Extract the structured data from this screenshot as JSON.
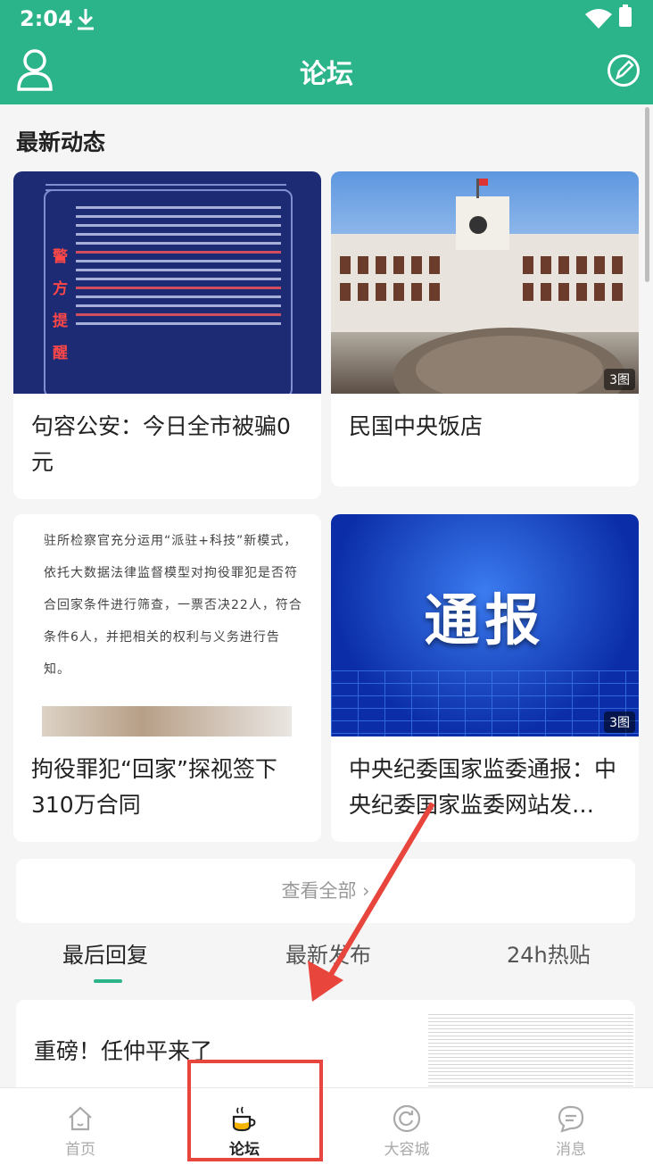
{
  "status_bar": {
    "time": "2:04"
  },
  "header": {
    "title": "论坛"
  },
  "section": {
    "title": "最新动态"
  },
  "cards": [
    {
      "title": "句容公安：今日全市被骗0元",
      "badge": ""
    },
    {
      "title": "民国中央饭店",
      "badge": "3图"
    },
    {
      "title": "拘役罪犯“回家”探视签下310万合同",
      "badge": ""
    },
    {
      "title": "中央纪委国家监委通报：中央纪委国家监委网站发…",
      "badge": "3图"
    }
  ],
  "card_images": {
    "police_vertical": [
      "警",
      "方",
      "提",
      "醒"
    ],
    "doc_text": "驻所检察官充分运用“派驻+科技”新模式，依托大数据法律监督模型对拘役罪犯是否符合回家条件进行筛查，一票否决22人，符合条件6人，并把相关的权利与义务进行告知。",
    "report_word": "通报"
  },
  "view_all": {
    "label": "查看全部 ›"
  },
  "tabs": [
    {
      "label": "最后回复",
      "active": true
    },
    {
      "label": "最新发布",
      "active": false
    },
    {
      "label": "24h热贴",
      "active": false
    }
  ],
  "post": {
    "title": "重磅！任仲平来了"
  },
  "bottom_nav": [
    {
      "label": "首页",
      "icon": "home-icon",
      "active": false
    },
    {
      "label": "论坛",
      "icon": "coffee-cup-icon",
      "active": true
    },
    {
      "label": "大容城",
      "icon": "refresh-circle-icon",
      "active": false
    },
    {
      "label": "消息",
      "icon": "chat-bubble-icon",
      "active": false
    }
  ],
  "colors": {
    "brand": "#2bb38a",
    "annotation": "#e8453c"
  }
}
